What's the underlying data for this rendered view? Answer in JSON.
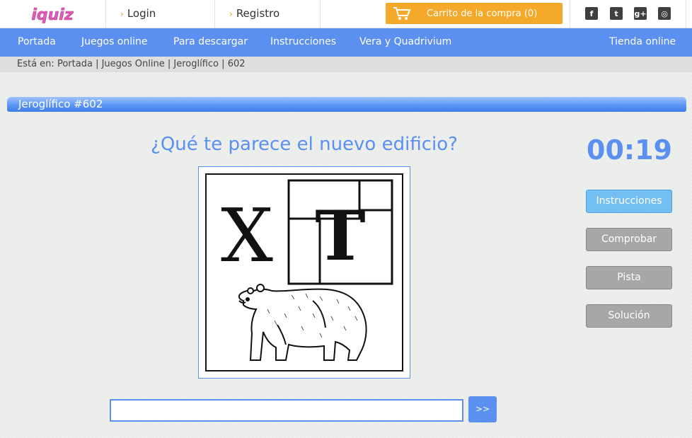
{
  "header": {
    "logo_text": "iquiz",
    "login_label": "Login",
    "register_label": "Registro",
    "cart_label": "Carrito de la compra (0)",
    "social": [
      {
        "icon": "facebook-icon",
        "glyph": "f"
      },
      {
        "icon": "twitter-icon",
        "glyph": "t"
      },
      {
        "icon": "google-plus-icon",
        "glyph": "g+"
      },
      {
        "icon": "instagram-icon",
        "glyph": "◎"
      }
    ]
  },
  "nav": {
    "items": [
      "Portada",
      "Juegos online",
      "Para descargar",
      "Instrucciones",
      "Vera y Quadrivium"
    ],
    "right_item": "Tienda online"
  },
  "breadcrumb": {
    "prefix": "Está en:",
    "items": [
      "Portada",
      "Juegos Online",
      "Jeroglífico",
      "602"
    ],
    "separator": "|"
  },
  "page_title": "Jeroglífico #602",
  "puzzle": {
    "question": "¿Qué te parece el nuevo edificio?",
    "image_letters": [
      "X",
      "T"
    ],
    "image_subject": "bear"
  },
  "timer": "00:19",
  "buttons": {
    "instructions": "Instrucciones",
    "check": "Comprobar",
    "hint": "Pista",
    "solution": "Solución",
    "submit": ">>"
  },
  "answer": {
    "value": "",
    "placeholder": ""
  },
  "colors": {
    "accent": "#5b8ff0",
    "cart": "#f4a92a",
    "logo": "#e45bb6"
  }
}
